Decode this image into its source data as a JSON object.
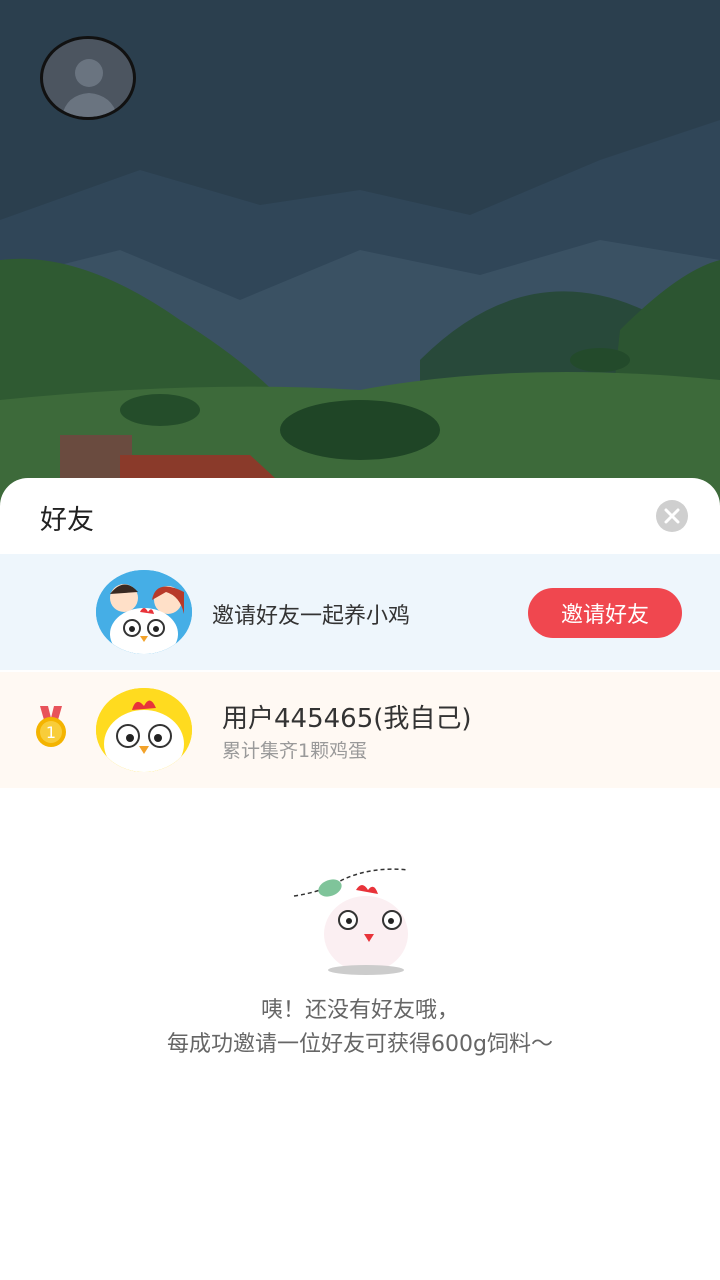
{
  "sheet": {
    "title": "好友",
    "close_icon": "close-icon"
  },
  "invite": {
    "text": "邀请好友一起养小鸡",
    "button_label": "邀请好友"
  },
  "ranking": [
    {
      "rank": "1",
      "name": "用户445465(我自己)",
      "subtitle": "累计集齐1颗鸡蛋"
    }
  ],
  "empty_state": {
    "line1": "咦！还没有好友哦，",
    "line2": "每成功邀请一位好友可获得600g饲料～"
  },
  "colors": {
    "accent": "#f0474f",
    "invite_bg": "#eef6fc",
    "rank_bg": "#fff9f3"
  }
}
